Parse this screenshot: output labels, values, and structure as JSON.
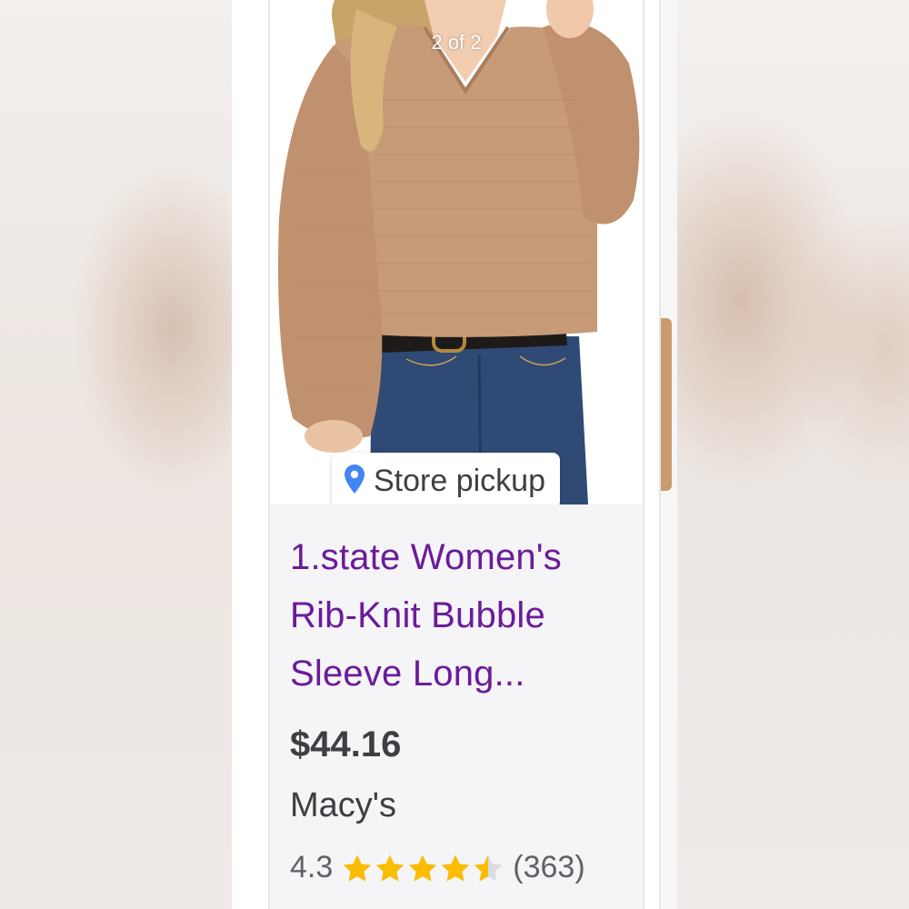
{
  "image_counter": "2 of 2",
  "store_pickup": {
    "label": "Store pickup",
    "icon": "location-pin-icon",
    "icon_color": "#4285f4"
  },
  "product": {
    "title_lines": [
      "1.state Women's",
      "Rib-Knit Bubble",
      "Sleeve Long..."
    ],
    "price": "$44.16",
    "seller": "Macy's",
    "rating": "4.3",
    "rating_value": 4.3,
    "max_rating": 5,
    "review_count": "(363)"
  },
  "colors": {
    "title": "#6a1b9a",
    "star": "#fbbc04",
    "text": "#3c4043"
  }
}
